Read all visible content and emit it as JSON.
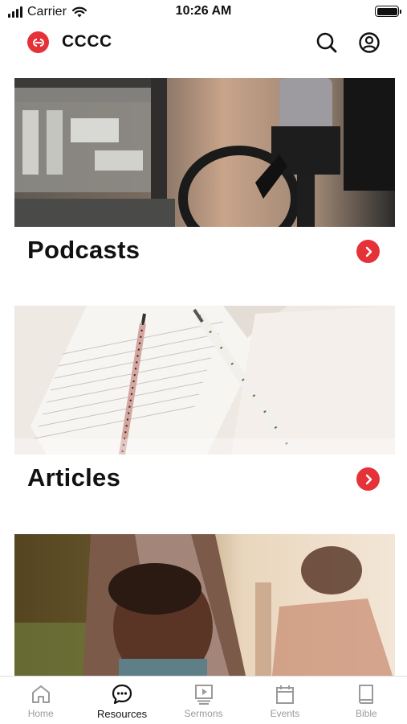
{
  "status_bar": {
    "carrier": "Carrier",
    "time": "10:26 AM"
  },
  "header": {
    "title": "CCCC"
  },
  "cards": [
    {
      "title": "Podcasts"
    },
    {
      "title": "Articles"
    },
    {
      "title": ""
    }
  ],
  "tabbar": {
    "tabs": [
      {
        "label": "Home",
        "icon": "home-icon"
      },
      {
        "label": "Resources",
        "icon": "chat-bubble-icon"
      },
      {
        "label": "Sermons",
        "icon": "video-playlist-icon"
      },
      {
        "label": "Events",
        "icon": "calendar-icon"
      },
      {
        "label": "Bible",
        "icon": "book-icon"
      }
    ],
    "active": "Resources"
  },
  "colors": {
    "accent": "#e53238",
    "inactive_tab": "#9a9a9a"
  }
}
